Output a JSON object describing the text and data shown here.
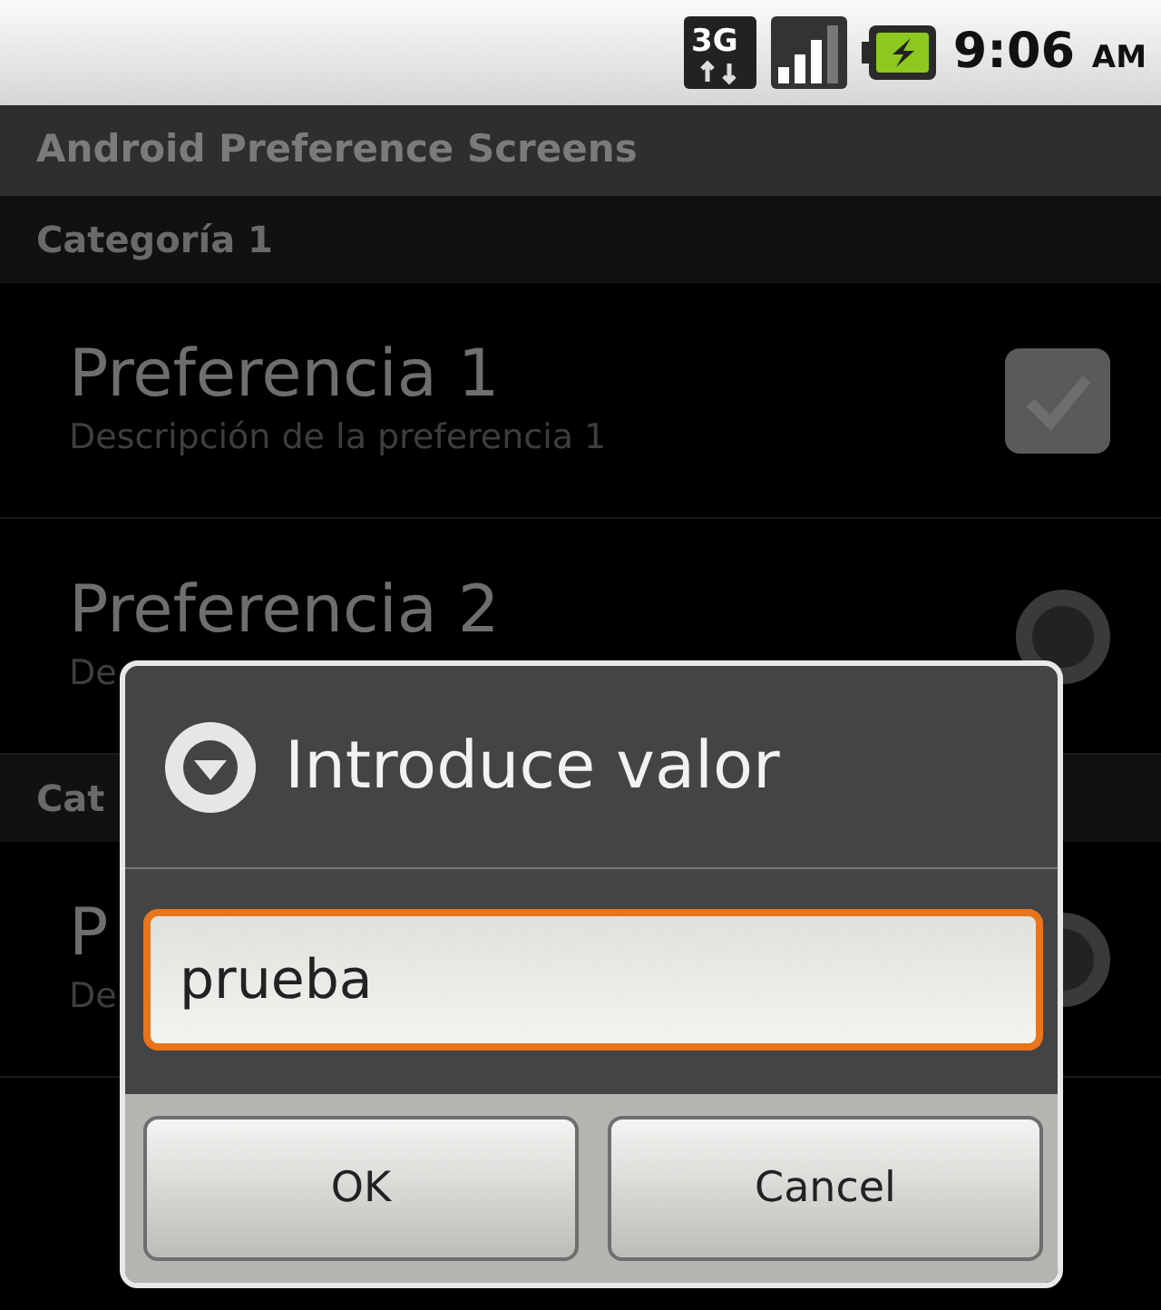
{
  "status_bar": {
    "network": "3G",
    "time": "9:06",
    "meridiem": "AM"
  },
  "app_title": "Android Preference Screens",
  "sections": [
    {
      "category": "Categoría 1",
      "items": [
        {
          "kind": "checkbox",
          "title": "Preferencia 1",
          "summary": "Descripción de la preferencia 1",
          "checked": true
        },
        {
          "kind": "radio",
          "title": "Preferencia 2",
          "summary": "De",
          "checked": false
        }
      ]
    },
    {
      "category": "Cat",
      "items": [
        {
          "kind": "radio",
          "title": "P",
          "summary": "De",
          "checked": false
        }
      ]
    }
  ],
  "dialog": {
    "title": "Introduce valor",
    "value": "prueba",
    "buttons": [
      "OK",
      "Cancel"
    ]
  }
}
